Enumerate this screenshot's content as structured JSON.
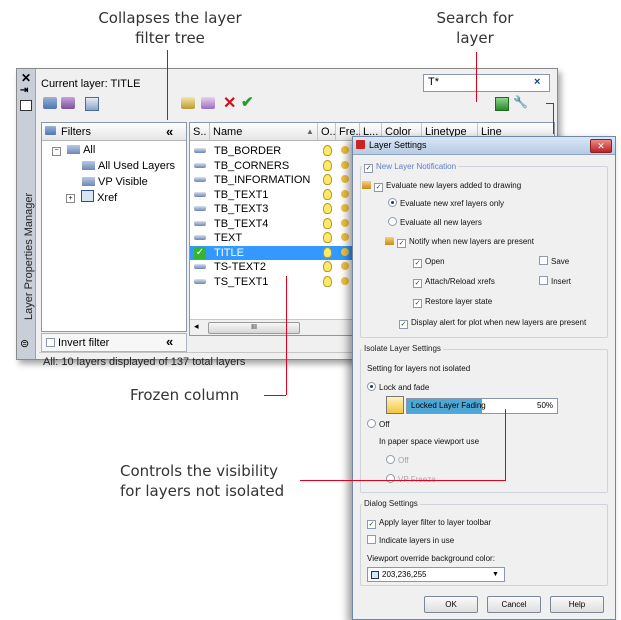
{
  "callouts": {
    "collapse_line1": "Collapses the layer",
    "collapse_line2": "filter tree",
    "search_line1": "Search for",
    "search_line2": "layer",
    "frozen": "Frozen column",
    "visibility_line1": "Controls the visibility",
    "visibility_line2": "for layers not isolated"
  },
  "palette": {
    "vertical_title": "Layer Properties Manager",
    "current_layer": "Current layer: TITLE",
    "search_value": "T*",
    "filters_header": "Filters",
    "collapse_glyph": "«",
    "tree": [
      "All",
      "All Used Layers",
      "VP Visible",
      "Xref"
    ],
    "invert_filter": "Invert filter",
    "status": "All: 10 layers displayed of 137 total layers",
    "columns": [
      "S..",
      "Name",
      "O..",
      "Fre...",
      "L...",
      "Color",
      "Linetype",
      "Line"
    ],
    "layers": [
      "TB_BORDER",
      "TB_CORNERS",
      "TB_INFORMATION",
      "TB_TEXT1",
      "TB_TEXT3",
      "TB_TEXT4",
      "TEXT",
      "TITLE",
      "TS-TEXT2",
      "TS_TEXT1"
    ],
    "selected_layer": "TITLE",
    "scroll_glyph": "III"
  },
  "dialog": {
    "title": "Layer Settings",
    "new_layer_notification": "New Layer Notification",
    "evaluate_new": "Evaluate new layers added to drawing",
    "evaluate_xref": "Evaluate new xref layers only",
    "evaluate_all": "Evaluate all new layers",
    "notify": "Notify when new layers are present",
    "open": "Open",
    "save": "Save",
    "attach": "Attach/Reload xrefs",
    "insert": "Insert",
    "restore": "Restore layer state",
    "display_alert": "Display alert for plot when new layers are present",
    "isolate_group": "Isolate Layer Settings",
    "setting_not_isolated": "Setting for layers not isolated",
    "lock_fade": "Lock and fade",
    "fading_label": "Locked Layer Fading",
    "fading_value": "50%",
    "fading_fraction": 0.5,
    "off": "Off",
    "paper_space": "In paper space viewport use",
    "off_sub": "Off",
    "vp_freeze": "VP Freeze",
    "dialog_group": "Dialog Settings",
    "apply_filter": "Apply layer filter to layer toolbar",
    "indicate_in_use": "Indicate layers in use",
    "viewport_override": "Viewport override background color:",
    "color_value": "203,236,255",
    "ok": "OK",
    "cancel": "Cancel",
    "help": "Help"
  },
  "colors": {
    "leader": "#e2001a",
    "selected_row": "#3399ff",
    "fade_slider": "#4da8d8",
    "swatch": "#cbecff"
  }
}
